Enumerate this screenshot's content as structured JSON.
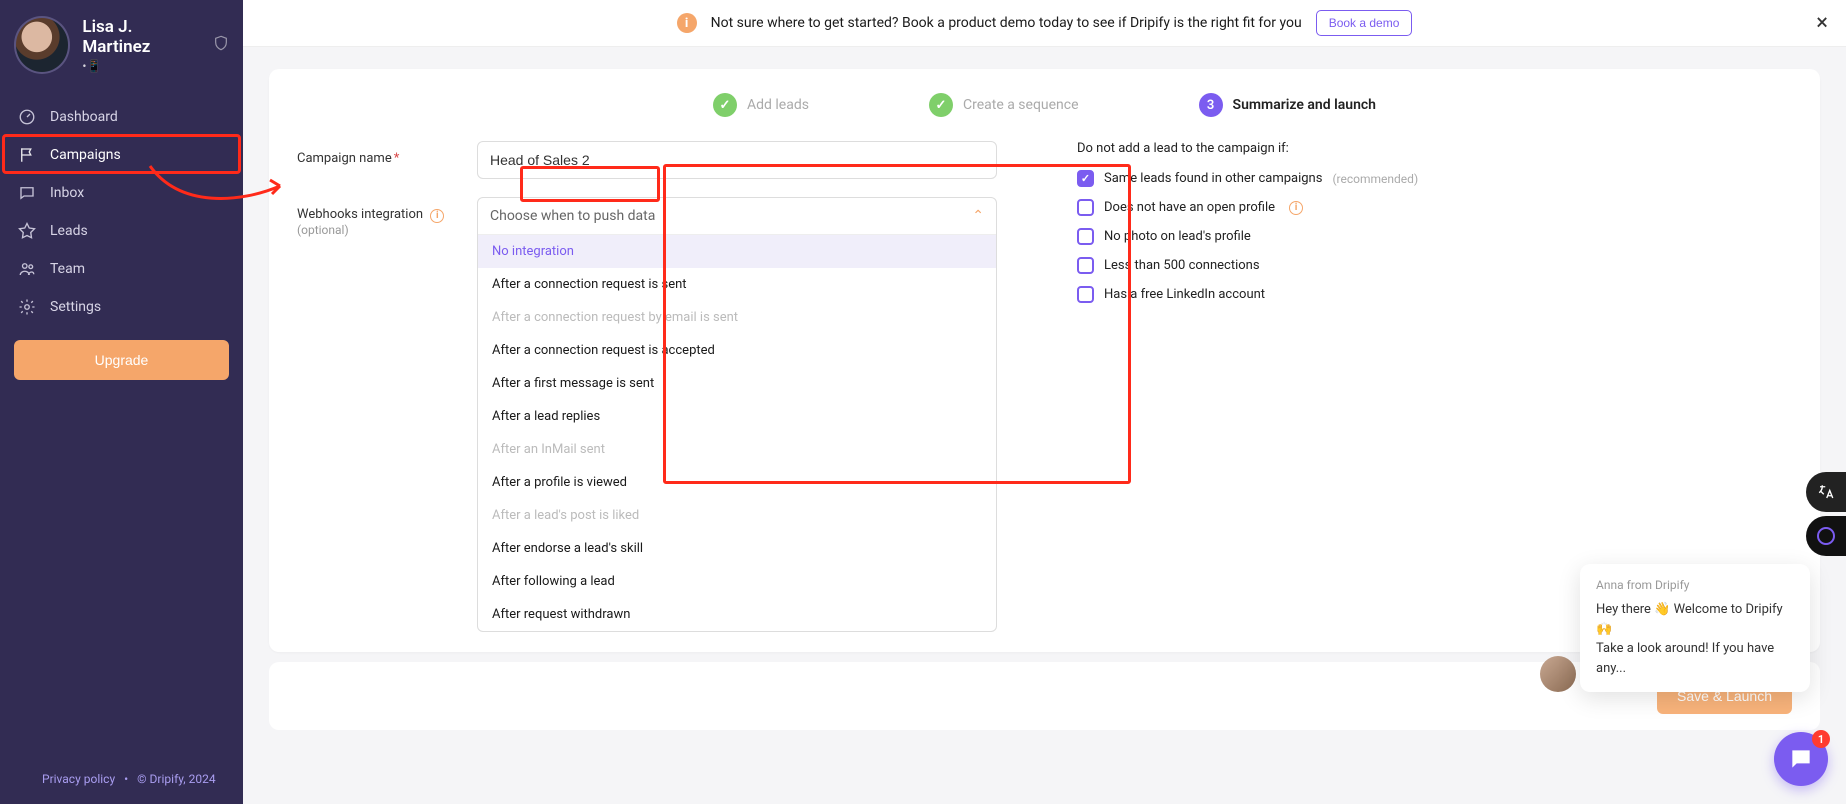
{
  "user": {
    "name": "Lisa J. Martinez",
    "sub": "•📱"
  },
  "nav": {
    "items": [
      {
        "label": "Dashboard"
      },
      {
        "label": "Campaigns"
      },
      {
        "label": "Inbox"
      },
      {
        "label": "Leads"
      },
      {
        "label": "Team"
      },
      {
        "label": "Settings"
      }
    ],
    "upgrade": "Upgrade"
  },
  "footer": {
    "privacy": "Privacy policy",
    "copyright": "© Dripify, 2024"
  },
  "banner": {
    "text": "Not sure where to get started? Book a product demo today to see if Dripify is the right fit for you",
    "cta": "Book a demo"
  },
  "stepper": {
    "step1": "Add leads",
    "step2": "Create a sequence",
    "step3_num": "3",
    "step3": "Summarize and launch"
  },
  "form": {
    "name_label": "Campaign name",
    "name_value": "Head of Sales 2",
    "webhooks_label": "Webhooks integration",
    "webhooks_opt": "(optional)",
    "select_placeholder": "Choose when to push data",
    "options": [
      {
        "label": "No integration",
        "state": "selected"
      },
      {
        "label": "After a connection request is sent",
        "state": ""
      },
      {
        "label": "After a connection request by email is sent",
        "state": "disabled"
      },
      {
        "label": "After a connection request is accepted",
        "state": ""
      },
      {
        "label": "After a first message is sent",
        "state": ""
      },
      {
        "label": "After a lead replies",
        "state": ""
      },
      {
        "label": "After an InMail sent",
        "state": "disabled"
      },
      {
        "label": "After a profile is viewed",
        "state": ""
      },
      {
        "label": "After a lead's post is liked",
        "state": "disabled"
      },
      {
        "label": "After endorse a lead's skill",
        "state": ""
      },
      {
        "label": "After following a lead",
        "state": ""
      },
      {
        "label": "After request withdrawn",
        "state": ""
      }
    ]
  },
  "exclusions": {
    "title": "Do not add a lead to the campaign if:",
    "items": [
      {
        "label": "Same leads found in other campaigns",
        "suffix": "(recommended)",
        "checked": true
      },
      {
        "label": "Does not have an open profile",
        "info": true
      },
      {
        "label": "No photo on lead's profile"
      },
      {
        "label": "Less than 500 connections"
      },
      {
        "label": "Has a free LinkedIn account"
      }
    ]
  },
  "actions": {
    "save": "Save & Launch"
  },
  "chat": {
    "from": "Anna from Dripify",
    "line1": "Hey there 👋 Welcome to Dripify 🙌",
    "line2": "Take a look around! If you have any...",
    "badge": "1"
  }
}
